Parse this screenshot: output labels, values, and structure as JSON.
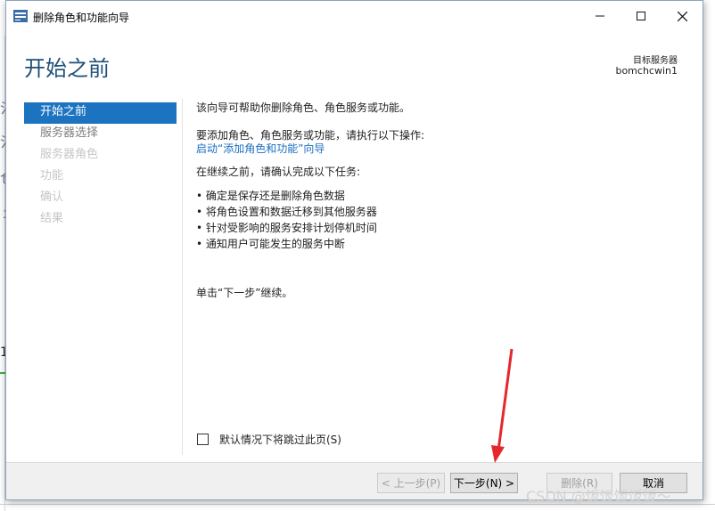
{
  "window": {
    "title": "删除角色和功能向导",
    "icon": "server-manager-icon"
  },
  "header": {
    "page_title": "开始之前",
    "target_label": "目标服务器",
    "target_value": "bomchcwin1"
  },
  "nav": {
    "items": [
      {
        "label": "开始之前",
        "state": "active"
      },
      {
        "label": "服务器选择",
        "state": "normal"
      },
      {
        "label": "服务器角色",
        "state": "disabled"
      },
      {
        "label": "功能",
        "state": "disabled"
      },
      {
        "label": "确认",
        "state": "disabled"
      },
      {
        "label": "结果",
        "state": "disabled"
      }
    ]
  },
  "content": {
    "intro": "该向导可帮助你删除角色、角色服务或功能。",
    "add_prompt": "要添加角色、角色服务或功能，请执行以下操作:",
    "add_link": "启动“添加角色和功能”向导",
    "confirm_prompt": "在继续之前，请确认完成以下任务:",
    "bullets": [
      "• 确定是保存还是删除角色数据",
      "• 将角色设置和数据迁移到其他服务器",
      "• 针对受影响的服务安排计划停机时间",
      "• 通知用户可能发生的服务中断"
    ],
    "continue_hint": "单击“下一步”继续。"
  },
  "skip": {
    "label": "默认情况下将跳过此页(S)",
    "checked": false
  },
  "footer": {
    "prev_label": "< 上一步(P)",
    "next_label": "下一步(N) >",
    "remove_label": "删除(R)",
    "cancel_label": "取消"
  },
  "background": {
    "glyphs": [
      "氵",
      "氵",
      "仓",
      "丬"
    ],
    "row_number": "1"
  },
  "watermark": "CSDN @饭饭饭饭饭～",
  "colors": {
    "accent": "#1c73c0",
    "title": "#1f4e79",
    "link": "#1b6ec2",
    "annotation_arrow": "#e5282b"
  }
}
